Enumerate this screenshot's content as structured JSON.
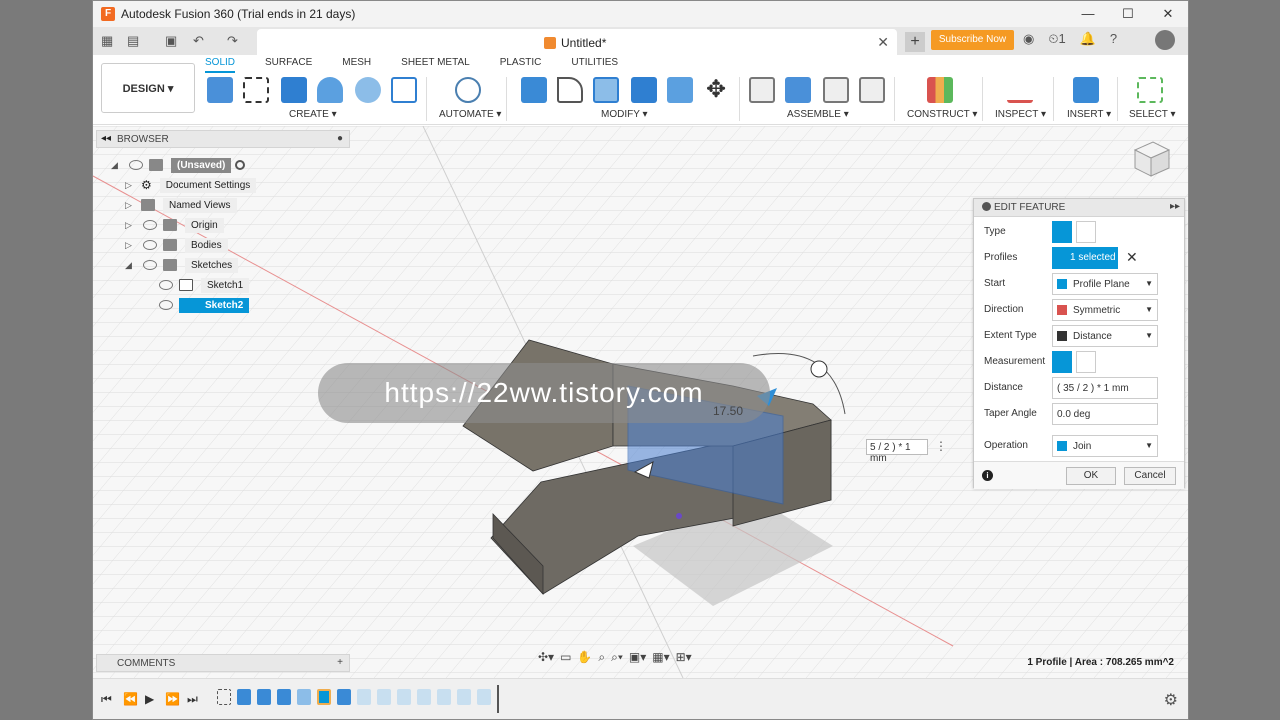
{
  "window": {
    "title": "Autodesk Fusion 360 (Trial ends in 21 days)",
    "logo": "F",
    "minimize": "—",
    "maximize": "☐",
    "close": "✕"
  },
  "quickbar": {
    "grid_icon": "▦",
    "file_icon": "▤",
    "save_icon": "▣",
    "undo_icon": "↶",
    "redo_icon": "↷",
    "doc_title": "Untitled*",
    "doc_close": "✕",
    "new_tab": "+",
    "subscribe": "Subscribe Now",
    "status_icon": "◉",
    "clock_count": "1",
    "bell_icon": "🔔",
    "help_icon": "?"
  },
  "toolbar": {
    "workspace": "DESIGN ▾",
    "tabs": [
      "SOLID",
      "SURFACE",
      "MESH",
      "SHEET METAL",
      "PLASTIC",
      "UTILITIES"
    ],
    "active_tab": "SOLID",
    "groups": [
      "CREATE ▾",
      "AUTOMATE ▾",
      "MODIFY ▾",
      "ASSEMBLE ▾",
      "CONSTRUCT ▾",
      "INSPECT ▾",
      "INSERT ▾",
      "SELECT ▾"
    ]
  },
  "browser": {
    "title": "BROWSER",
    "items": [
      {
        "label": "(Unsaved)"
      },
      {
        "label": "Document Settings"
      },
      {
        "label": "Named Views"
      },
      {
        "label": "Origin"
      },
      {
        "label": "Bodies"
      },
      {
        "label": "Sketches"
      },
      {
        "label": "Sketch1"
      },
      {
        "label": "Sketch2"
      }
    ]
  },
  "comments": {
    "title": "COMMENTS",
    "add": "+"
  },
  "watermark": "https://22ww.tistory.com",
  "edit_feature": {
    "title": "EDIT FEATURE",
    "rows": [
      {
        "label": "Type"
      },
      {
        "label": "Profiles",
        "value": "1 selected"
      },
      {
        "label": "Start",
        "value": "Profile Plane"
      },
      {
        "label": "Direction",
        "value": "Symmetric"
      },
      {
        "label": "Extent Type",
        "value": "Distance"
      },
      {
        "label": "Measurement"
      },
      {
        "label": "Distance",
        "value": "( 35 / 2 ) * 1 mm"
      },
      {
        "label": "Taper Angle",
        "value": "0.0 deg"
      },
      {
        "label": "Operation",
        "value": "Join"
      }
    ],
    "ok": "OK",
    "cancel": "Cancel",
    "info": "i"
  },
  "viewport": {
    "dim_label": "17.50",
    "dim_input": "5 / 2 ) * 1 mm",
    "dim_menu": "⋮",
    "profile_info": "1 Profile | Area : 708.265 mm^2"
  },
  "colors": {
    "accent": "#0696d7",
    "subscribe": "#f59a23",
    "body": "#6e6a63",
    "profile": "#4a7fd0"
  }
}
